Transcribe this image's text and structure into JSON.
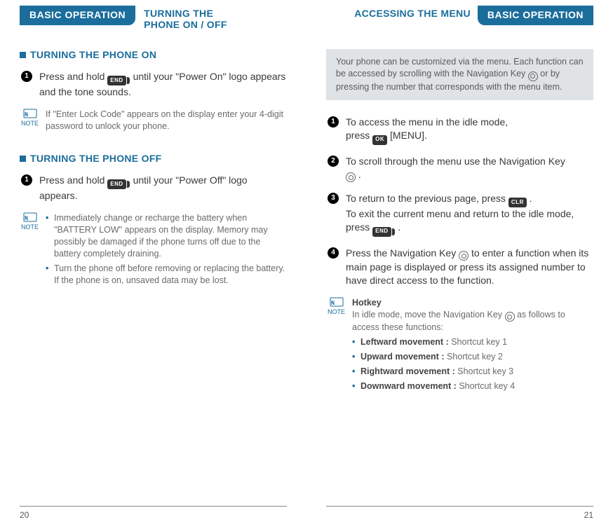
{
  "left": {
    "tab": "BASIC OPERATION",
    "subtitle": "TURNING THE PHONE ON / OFF",
    "section_on": "TURNING THE PHONE ON",
    "on_step1_a": "Press and hold ",
    "on_step1_b": " until your \"Power On\" logo appears and the tone sounds.",
    "on_note": "If \"Enter Lock Code\" appears on the display enter your 4-digit password to unlock your phone.",
    "section_off": "TURNING THE PHONE OFF",
    "off_step1_a": "Press and hold ",
    "off_step1_b": " until your \"Power Off\" logo appears.",
    "off_note_1": "Immediately change or recharge the battery when \"BATTERY LOW\" appears on the display. Memory may possibly be damaged if the phone turns off due to the battery completely draining.",
    "off_note_2": "Turn the phone off before removing or replacing the battery. If the phone is on, unsaved data may be lost.",
    "pageno": "20"
  },
  "right": {
    "subtitle": "ACCESSING THE MENU",
    "tab": "BASIC OPERATION",
    "infobox_a": "Your phone can be customized via the menu. Each function can be accessed by scrolling with the Navigation Key ",
    "infobox_b": " or by pressing the number that corresponds with the menu item.",
    "step1_a": "To access the menu in the idle mode,",
    "step1_b": "press ",
    "step1_c": " [MENU].",
    "step2_a": "To scroll through the menu use the Navigation Key ",
    "step2_b": " .",
    "step3_a": "To return to the previous page, press ",
    "step3_b": " .",
    "step3_c": "To exit the current menu and return to the idle mode, press ",
    "step3_d": " .",
    "step4_a": "Press the Navigation Key ",
    "step4_b": " to enter a function when its main page is displayed or press its assigned number to have direct access to the function.",
    "hotkey_title": "Hotkey",
    "hotkey_intro_a": "In idle mode, move the Navigation Key ",
    "hotkey_intro_b": " as follows to access these functions:",
    "hk1_label": "Leftward movement : ",
    "hk1_val": "Shortcut key 1",
    "hk2_label": "Upward movement : ",
    "hk2_val": "Shortcut key 2",
    "hk3_label": "Rightward movement : ",
    "hk3_val": "Shortcut key 3",
    "hk4_label": "Downward movement : ",
    "hk4_val": "Shortcut key 4",
    "pageno": "21"
  },
  "keys": {
    "end": "END",
    "ok": "OK",
    "clr": "CLR"
  },
  "colors": {
    "accent": "#1b6d9c"
  }
}
